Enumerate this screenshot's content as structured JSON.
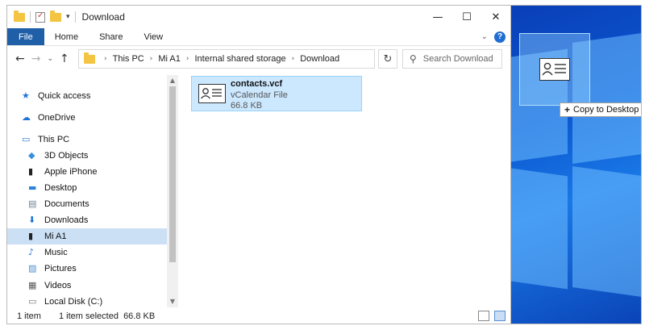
{
  "window": {
    "title": "Download",
    "controls": [
      "—",
      "☐",
      "✕"
    ]
  },
  "ribbon": {
    "tabs": [
      "File",
      "Home",
      "Share",
      "View"
    ],
    "help": "?"
  },
  "address": {
    "crumbs": [
      "This PC",
      "Mi A1",
      "Internal shared storage",
      "Download"
    ]
  },
  "search": {
    "placeholder": "Search Download"
  },
  "nav": {
    "items": [
      {
        "label": "Quick access",
        "icon": "star-icon"
      },
      {
        "label": "OneDrive",
        "icon": "cloud-icon"
      },
      {
        "label": "This PC",
        "icon": "pc-icon"
      },
      {
        "label": "3D Objects",
        "icon": "cube-icon"
      },
      {
        "label": "Apple iPhone",
        "icon": "phone-icon"
      },
      {
        "label": "Desktop",
        "icon": "desktop-icon"
      },
      {
        "label": "Documents",
        "icon": "documents-icon"
      },
      {
        "label": "Downloads",
        "icon": "download-arrow-icon"
      },
      {
        "label": "Mi A1",
        "icon": "phone-icon",
        "selected": true
      },
      {
        "label": "Music",
        "icon": "music-note-icon"
      },
      {
        "label": "Pictures",
        "icon": "pictures-icon"
      },
      {
        "label": "Videos",
        "icon": "video-icon"
      },
      {
        "label": "Local Disk (C:)",
        "icon": "disk-icon"
      }
    ]
  },
  "file": {
    "name": "contacts.vcf",
    "type": "vCalendar File",
    "size": "66.8 KB",
    "icon": "vcard-icon"
  },
  "status": {
    "count": "1 item",
    "selection": "1 item selected  66.8 KB"
  },
  "drag": {
    "tooltip": "Copy to Desktop",
    "tooltip_icon": "+"
  },
  "colors": {
    "accent": "#1f5fa7",
    "selection": "#cce8ff",
    "desktop": "#0b57d0"
  }
}
